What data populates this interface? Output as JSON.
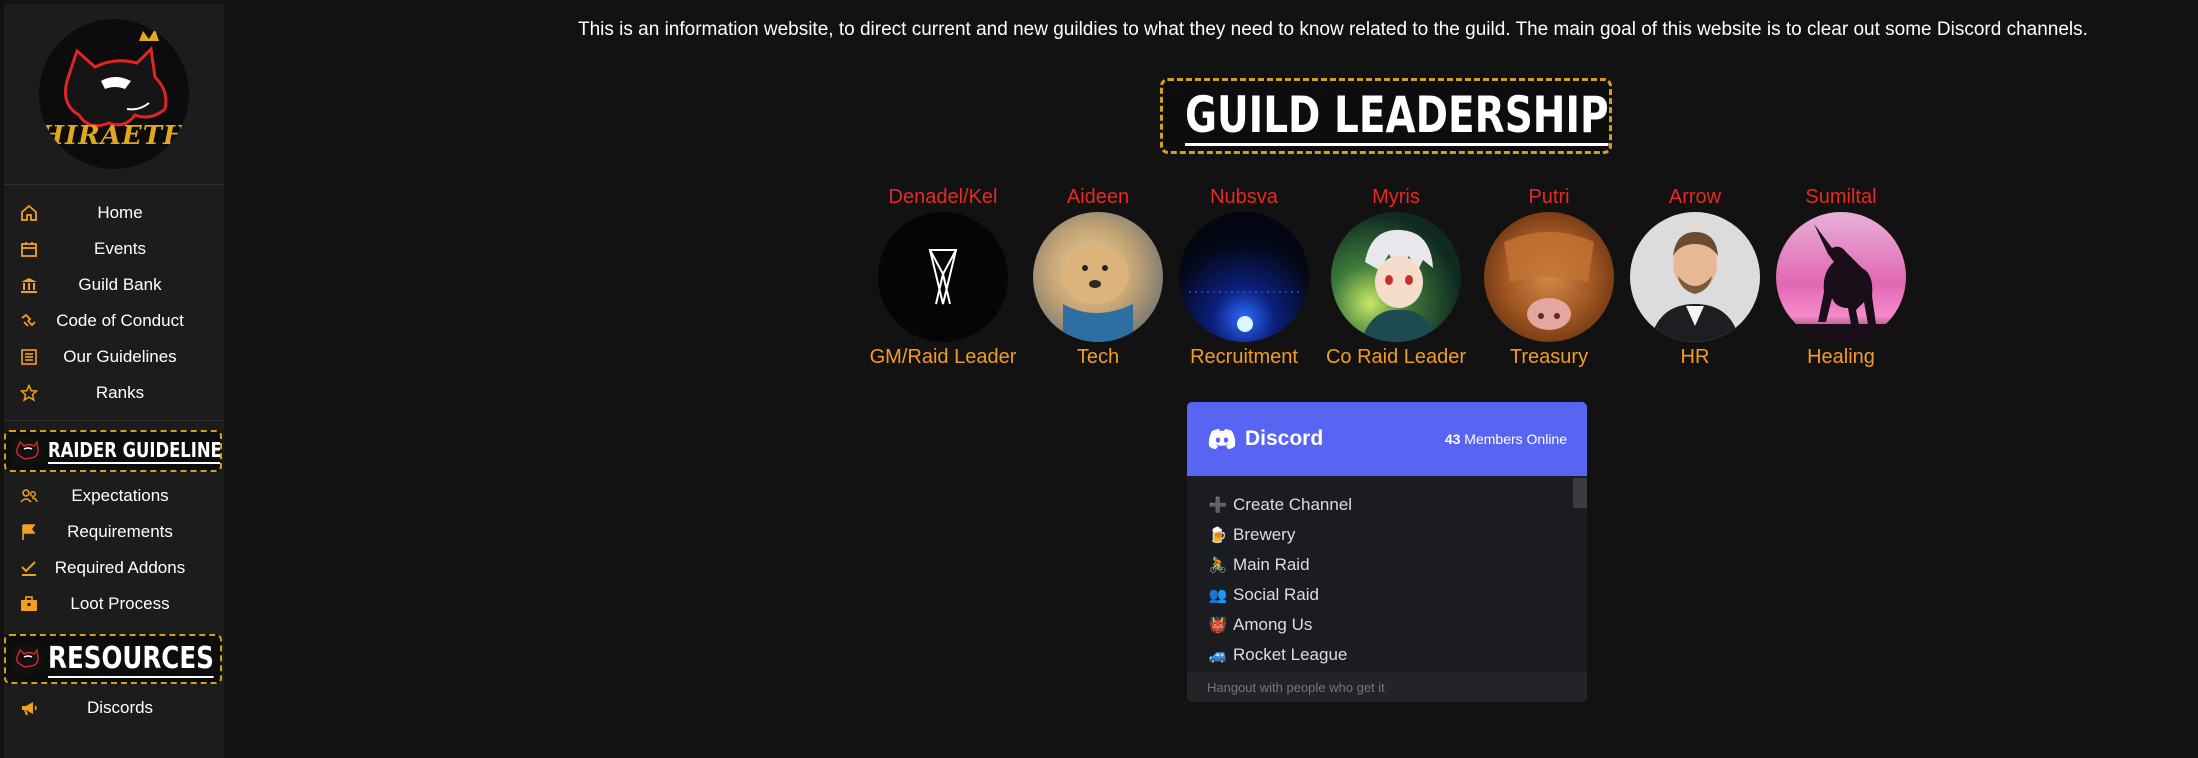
{
  "logo": {
    "text": "HIRAETH"
  },
  "sidebar": {
    "items": [
      {
        "label": "Home",
        "icon": "home-icon"
      },
      {
        "label": "Events",
        "icon": "calendar-icon"
      },
      {
        "label": "Guild Bank",
        "icon": "bank-icon"
      },
      {
        "label": "Code of Conduct",
        "icon": "handshake-icon"
      },
      {
        "label": "Our Guidelines",
        "icon": "list-icon"
      },
      {
        "label": "Ranks",
        "icon": "star-icon"
      }
    ],
    "raider_banner": "RAIDER GUIDELINES",
    "raider_items": [
      {
        "label": "Expectations",
        "icon": "users-icon"
      },
      {
        "label": "Requirements",
        "icon": "flag-icon"
      },
      {
        "label": "Required Addons",
        "icon": "check-list-icon"
      },
      {
        "label": "Loot Process",
        "icon": "briefcase-icon"
      }
    ],
    "resources_banner": "RESOURCES",
    "resource_items": [
      {
        "label": "Discords",
        "icon": "megaphone-icon"
      }
    ]
  },
  "intro": "This is an information website, to direct current and new guildies to what they need to know related to the guild. The main goal of this website is to clear out some Discord channels.",
  "leadership": {
    "title": "GUILD LEADERSHIP",
    "members": [
      {
        "name": "Denadel/Kel",
        "role": "GM/Raid Leader"
      },
      {
        "name": "Aideen",
        "role": "Tech"
      },
      {
        "name": "Nubsva",
        "role": "Recruitment"
      },
      {
        "name": "Myris",
        "role": "Co Raid Leader"
      },
      {
        "name": "Putri",
        "role": "Treasury"
      },
      {
        "name": "Arrow",
        "role": "HR"
      },
      {
        "name": "Sumiltal",
        "role": "Healing"
      }
    ]
  },
  "discord": {
    "brand": "Discord",
    "online_count": "43",
    "online_label": "Members Online",
    "channels": [
      {
        "emoji": "➕",
        "name": "Create Channel"
      },
      {
        "emoji": "🍺",
        "name": "Brewery"
      },
      {
        "emoji": "🚴",
        "name": "Main Raid"
      },
      {
        "emoji": "👥",
        "name": "Social Raid"
      },
      {
        "emoji": "👹",
        "name": "Among Us"
      },
      {
        "emoji": "🚙",
        "name": "Rocket League"
      }
    ],
    "footer": "Hangout with people who get it"
  },
  "colors": {
    "accent_gold": "#d4a017",
    "icon_orange": "#f0a020",
    "name_red": "#e8291f",
    "role_orange": "#f39c22",
    "discord_blurple": "#5865f2"
  }
}
